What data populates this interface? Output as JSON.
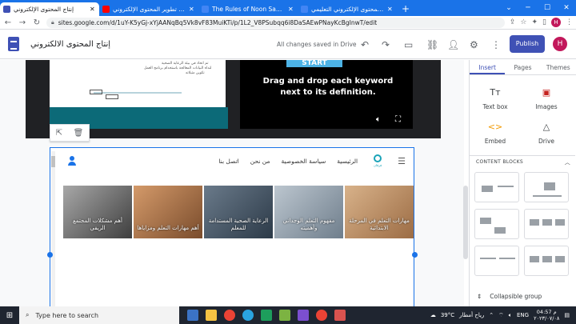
{
  "browser": {
    "tabs": [
      {
        "title": "إنتاج المحتوى الإلكتروني",
        "favicon_color": "#3f51b5",
        "active": true
      },
      {
        "title": "دورة تطوير المحتوى الإلكتروني - YouTube",
        "favicon_color": "#ff0000",
        "active": false
      },
      {
        "title": "The Rules of Noon Sakinah and Tanween",
        "favicon_color": "#4285f4",
        "active": false
      },
      {
        "title": "أنواع المحتوى الإلكتروني التعليمي",
        "favicon_color": "#4285f4",
        "active": false
      }
    ],
    "new_tab": "+",
    "url": "sites.google.com/d/1uY-K5yGj-xYjAANqBq5Vk8vF83MuiKTi/p/1L2_V8PSubqq6i8DaSAEwPNayKcBgInwT/edit"
  },
  "sites_header": {
    "title": "إنتاج المحتوى الالكتروني",
    "save_status": "All changes saved in Drive",
    "publish_label": "Publish",
    "avatar_letter": "H"
  },
  "canvas": {
    "video_start": "START",
    "video_text": "Drag and drop each keyword next to its definition.",
    "doc_text_1": "تم اتخاذ في بيئة الرعاية الصحية",
    "doc_text_2": "لتداه البيانات المعالجة باستخدام برنامج العمل",
    "doc_text_3": "تكوين مثيلاته"
  },
  "embed": {
    "nav_items": [
      "الرئيسية",
      "سياسة الخصوصية",
      "من نحن",
      "اتصل بنا"
    ],
    "logo_text": "فرقان",
    "cards": [
      {
        "title": "مهارات التعلم في المرحلة الابتدائية",
        "bg": "#b88c5a"
      },
      {
        "title": "مفهوم التعلم الوجداني وأهميته",
        "bg": "#8a9aa8"
      },
      {
        "title": "الرعاية الصحية المستدامة للمعلم",
        "bg": "#4a5a6a"
      },
      {
        "title": "أهم مهارات التعلم ومزاياها",
        "bg": "#b07a52"
      },
      {
        "title": "أهم مشكلات المجتمع الريفي",
        "bg": "#6e6e6e"
      }
    ]
  },
  "panel": {
    "tabs": [
      "Insert",
      "Pages",
      "Themes"
    ],
    "items": [
      {
        "label": "Text box",
        "icon": "Tт"
      },
      {
        "label": "Images",
        "icon": "▣"
      },
      {
        "label": "Embed",
        "icon": "<>"
      },
      {
        "label": "Drive",
        "icon": "△"
      }
    ],
    "section": "CONTENT BLOCKS",
    "collapsible": "Collapsible group"
  },
  "taskbar": {
    "search_placeholder": "Type here to search",
    "temperature": "39°C",
    "weather": "رياح أمطار",
    "lang": "ENG",
    "time": "04:57 م",
    "date": "٢٠٢٣/٠٧/٠٨"
  }
}
